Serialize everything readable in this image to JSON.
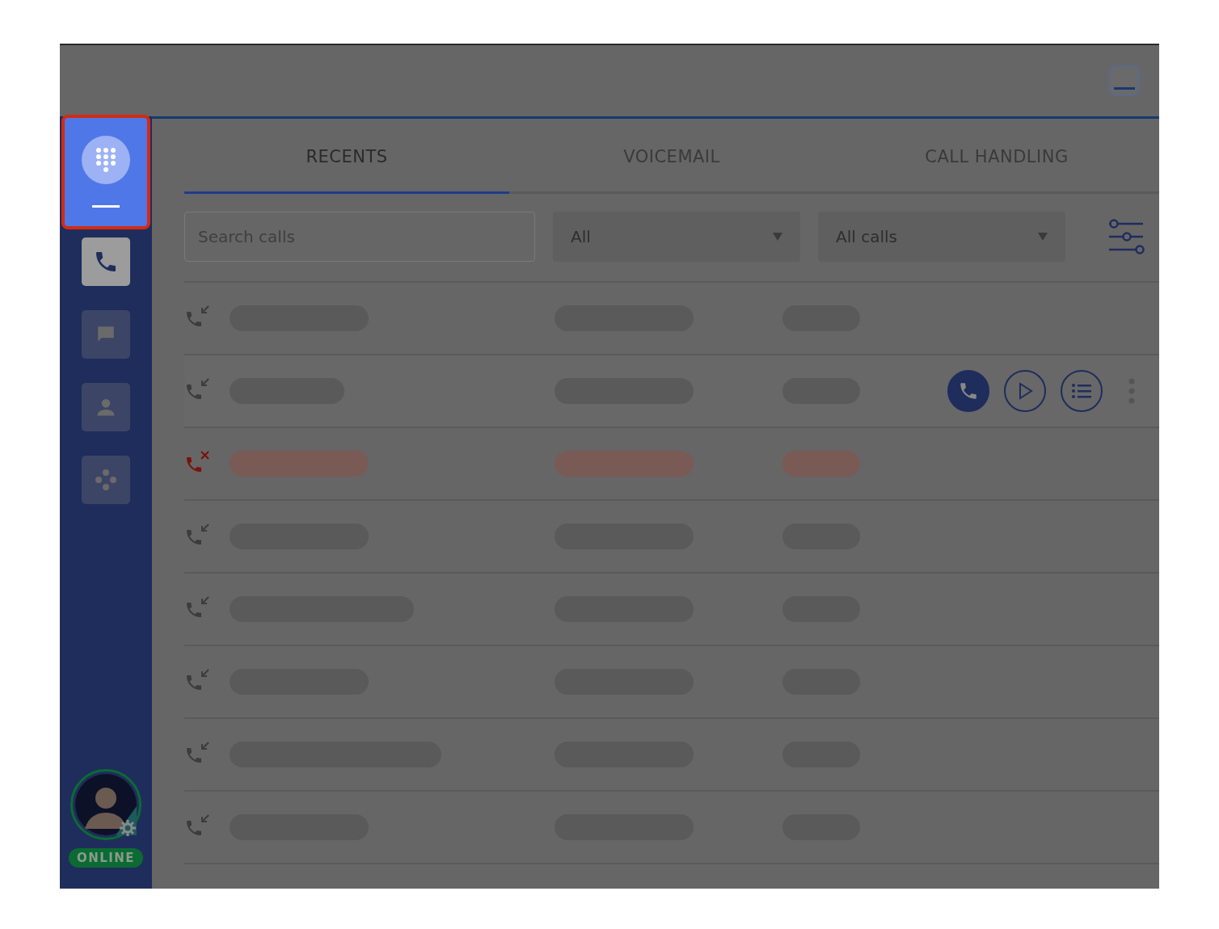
{
  "sidebar": {
    "dialpad": {
      "selected": true
    },
    "items": [
      {
        "disabled": false
      },
      {
        "disabled": true
      },
      {
        "disabled": true
      },
      {
        "disabled": true
      }
    ],
    "status": {
      "label": "ONLINE",
      "color": "#0b6b32"
    }
  },
  "tabs": [
    {
      "label": "RECENTS",
      "selected": true
    },
    {
      "label": "VOICEMAIL",
      "selected": false
    },
    {
      "label": "CALL HANDLING",
      "selected": false
    }
  ],
  "filters": {
    "search": {
      "placeholder": "Search calls"
    },
    "dropdowns": [
      {
        "value": "All"
      },
      {
        "value": "All calls"
      }
    ]
  },
  "calls": [
    {
      "kind": "incoming",
      "hovered": false
    },
    {
      "kind": "incoming",
      "hovered": true
    },
    {
      "kind": "missed",
      "hovered": false
    },
    {
      "kind": "incoming",
      "hovered": false
    },
    {
      "kind": "incoming",
      "hovered": false
    },
    {
      "kind": "incoming",
      "hovered": false
    },
    {
      "kind": "incoming",
      "hovered": false
    },
    {
      "kind": "incoming",
      "hovered": false
    }
  ]
}
